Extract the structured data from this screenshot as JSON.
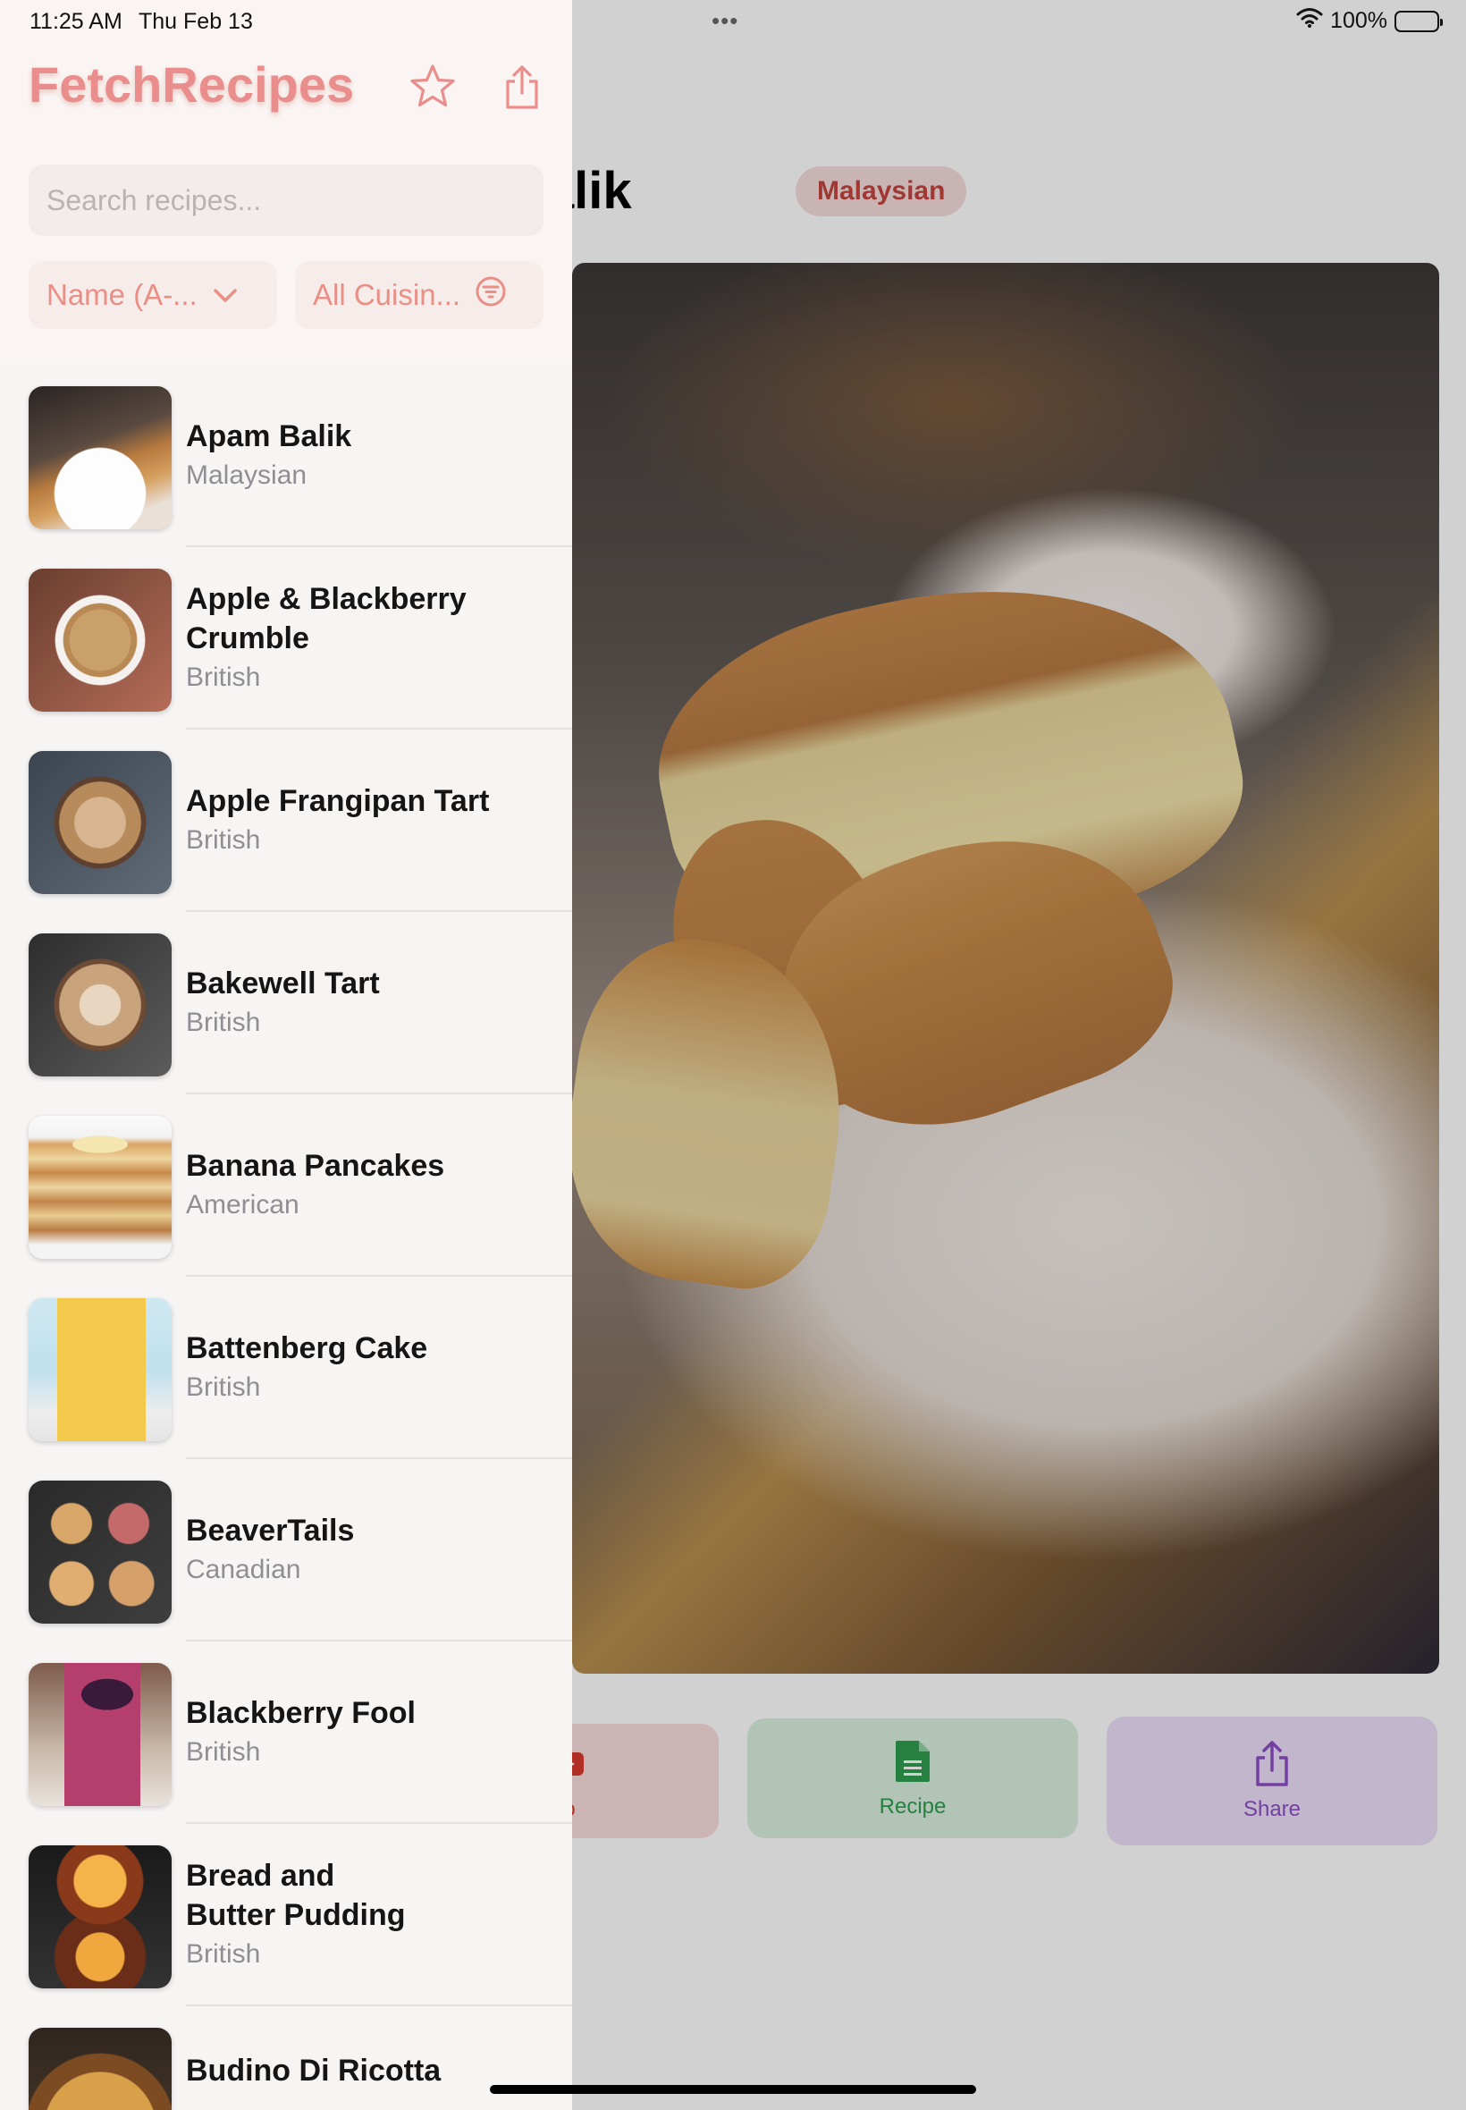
{
  "status_bar": {
    "time": "11:25 AM",
    "date": "Thu Feb 13",
    "multitask_dots": "•••",
    "battery": "100%"
  },
  "sidebar": {
    "app_title": "FetchRecipes",
    "search_placeholder": "Search recipes...",
    "sort_label": "Name (A-...",
    "cuisine_filter_label": "All Cuisin...",
    "icons": {
      "favorites": "star-icon",
      "share": "share-icon",
      "sort": "chevron-down-icon",
      "filter": "filter-circle-icon"
    },
    "recipes": [
      {
        "name": "Apam Balik",
        "cuisine": "Malaysian"
      },
      {
        "name": "Apple & Blackberry Crumble",
        "cuisine": "British"
      },
      {
        "name": "Apple Frangipan Tart",
        "cuisine": "British"
      },
      {
        "name": "Bakewell Tart",
        "cuisine": "British"
      },
      {
        "name": "Banana Pancakes",
        "cuisine": "American"
      },
      {
        "name": "Battenberg Cake",
        "cuisine": "British"
      },
      {
        "name": "BeaverTails",
        "cuisine": "Canadian"
      },
      {
        "name": "Blackberry Fool",
        "cuisine": "British"
      },
      {
        "name": "Bread and Butter Pudding",
        "cuisine": "British"
      },
      {
        "name": "Budino Di Ricotta",
        "cuisine": ""
      }
    ]
  },
  "detail": {
    "title": "am Balik",
    "cuisine_badge": "Malaysian",
    "actions": {
      "youtube_label": "o",
      "recipe_label": "Recipe",
      "share_label": "Share"
    }
  },
  "colors": {
    "accent": "#E98E8C",
    "recipe_green": "#2F9E4F",
    "share_purple": "#8E4EC6",
    "youtube_red": "#D93A2F"
  }
}
